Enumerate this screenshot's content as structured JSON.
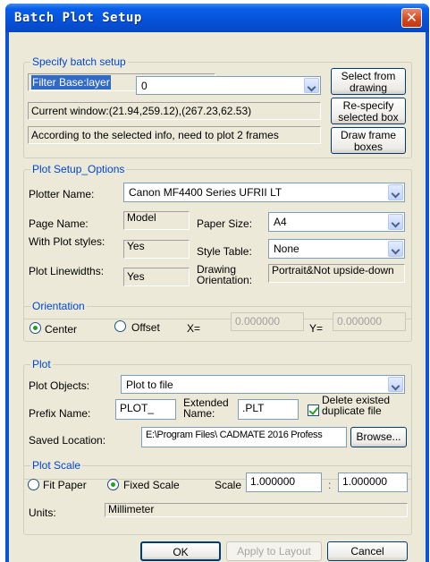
{
  "window": {
    "title": "Batch Plot Setup",
    "close_symbol": "✕"
  },
  "batch_setup": {
    "group_title": "Specify batch setup",
    "filter_label": "Filter Base:layer",
    "filter_value": "0",
    "select_from_drawing_button": "Select from drawing",
    "current_window": "Current window:(21.94,259.12),(267.23,62.53)",
    "respecify_button": "Re-specify selected box",
    "info_text": "According to the selected info, need to plot 2 frames",
    "draw_frame_button": "Draw frame boxes"
  },
  "plot_setup": {
    "group_title": "Plot Setup_Options",
    "plotter_label": "Plotter Name:",
    "plotter_value": "Canon MF4400 Series UFRII LT",
    "page_name_label": "Page Name:",
    "page_name_value": "Model",
    "paper_size_label": "Paper Size:",
    "paper_size_value": "A4",
    "with_plot_styles_label": "With Plot styles:",
    "with_plot_styles_value": "Yes",
    "style_table_label": "Style Table:",
    "style_table_value": "None",
    "plot_linewidths_label": "Plot Linewidths:",
    "plot_linewidths_value": "Yes",
    "drawing_orientation_label": "Drawing Orientation:",
    "drawing_orientation_value": "Portrait&Not upside-down"
  },
  "orientation": {
    "group_title": "Orientation",
    "center_label": "Center",
    "offset_label": "Offset",
    "selected": "Center",
    "x_label": "X=",
    "x_value": "0.000000",
    "y_label": "Y=",
    "y_value": "0.000000"
  },
  "plot": {
    "group_title": "Plot",
    "objects_label": "Plot Objects:",
    "objects_value": "Plot to file",
    "prefix_label": "Prefix Name:",
    "prefix_value": "PLOT_",
    "extended_label": "Extended Name:",
    "extended_value": ".PLT",
    "delete_label": "Delete existed duplicate file",
    "delete_checked": true,
    "saved_location_label": "Saved Location:",
    "saved_location_value": "E:\\Program Files\\ CADMATE 2016 Profess",
    "browse_button": "Browse..."
  },
  "plot_scale": {
    "group_title": "Plot Scale",
    "fit_paper_label": "Fit Paper",
    "fixed_scale_label": "Fixed Scale",
    "selected": "Fixed Scale",
    "scale_label": "Scale",
    "scale_value1": "1.000000",
    "separator": ":",
    "scale_value2": "1.000000",
    "units_label": "Units:",
    "units_value": "Millimeter"
  },
  "footer": {
    "ok_button": "OK",
    "apply_button": "Apply to Layout",
    "cancel_button": "Cancel"
  },
  "colors": {
    "title_bar": "#0552d9",
    "group_title": "#0046d5",
    "dialog_background": "#ece9d8",
    "selection_highlight": "#316ac5"
  }
}
